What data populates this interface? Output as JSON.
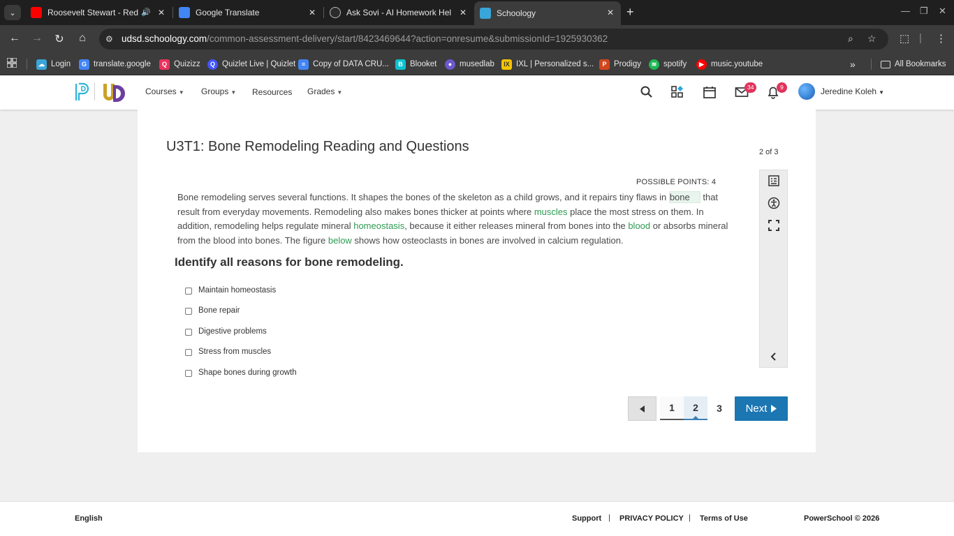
{
  "browser": {
    "tabs": [
      {
        "title": "Roosevelt Stewart - Redeem",
        "favicon": "youtube-icon",
        "color": "#ff0000"
      },
      {
        "title": "Google Translate",
        "favicon": "google-translate-icon",
        "color": "#4285f4"
      },
      {
        "title": "Ask Sovi - AI Homework Helper",
        "favicon": "sovi-icon",
        "color": "#2b2b2b"
      },
      {
        "title": "Schoology",
        "favicon": "powerschool-icon",
        "color": "#3aa5d8"
      }
    ],
    "url_host": "udsd.schoology.com",
    "url_path": "/common-assessment-delivery/start/8423469644?action=onresume&submissionId=1925930362",
    "bookmarks": [
      {
        "label": "Login"
      },
      {
        "label": "translate.google"
      },
      {
        "label": "Quizizz"
      },
      {
        "label": "Quizlet Live | Quizlet"
      },
      {
        "label": "Copy of DATA CRU..."
      },
      {
        "label": "Blooket"
      },
      {
        "label": "musedlab"
      },
      {
        "label": "IXL | Personalized s..."
      },
      {
        "label": "Prodigy"
      },
      {
        "label": "spotify"
      },
      {
        "label": "music.youtube"
      }
    ],
    "all_bookmarks": "All Bookmarks"
  },
  "header": {
    "nav": {
      "courses": "Courses",
      "groups": "Groups",
      "resources": "Resources",
      "grades": "Grades"
    },
    "mail_count": "34",
    "notif_count": "9",
    "user_name": "Jeredine Koleh"
  },
  "assessment": {
    "title": "U3T1: Bone Remodeling Reading and Questions",
    "page_count": "2 of 3",
    "points": "POSSIBLE POINTS: 4",
    "reading": {
      "p1": "Bone remodeling serves several functions. It shapes the bones of the skeleton as a child grows, and it repairs tiny flaws in ",
      "k_bone": "bone",
      "p2": " that result from everyday movements. Remodeling also makes bones thicker at points where ",
      "k_muscles": "muscles",
      "p3": " place the most stress on them. In addition, remodeling helps regulate mineral ",
      "k_homeostasis": "homeostasis",
      "p4": ", because it either releases mineral from bones into the ",
      "k_blood": "blood",
      "p5": " or absorbs mineral from the blood into bones. The figure ",
      "k_below": "below",
      "p6": " shows how osteoclasts in bones are involved in calcium regulation."
    },
    "question": "Identify all reasons for bone remodeling.",
    "options": [
      "Maintain homeostasis",
      "Bone repair",
      "Digestive problems",
      "Stress from muscles",
      "Shape bones during growth"
    ],
    "pages": [
      "1",
      "2",
      "3"
    ],
    "current_page": "2",
    "next_label": "Next"
  },
  "footer": {
    "language": "English",
    "support": "Support",
    "privacy": "PRIVACY POLICY",
    "terms": "Terms of Use",
    "sep": "|",
    "copyright": "PowerSchool © 2026"
  },
  "colors": {
    "accent": "#1b76b2",
    "keyword": "#2e9b52",
    "badge": "#e0345c"
  }
}
